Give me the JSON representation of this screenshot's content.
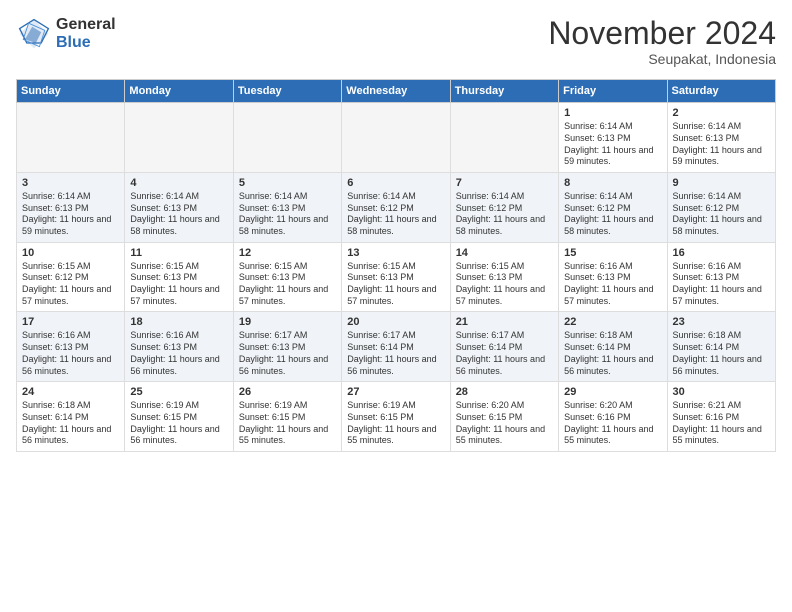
{
  "header": {
    "logo_general": "General",
    "logo_blue": "Blue",
    "month_title": "November 2024",
    "location": "Seupakat, Indonesia"
  },
  "weekdays": [
    "Sunday",
    "Monday",
    "Tuesday",
    "Wednesday",
    "Thursday",
    "Friday",
    "Saturday"
  ],
  "weeks": [
    [
      {
        "day": "",
        "info": ""
      },
      {
        "day": "",
        "info": ""
      },
      {
        "day": "",
        "info": ""
      },
      {
        "day": "",
        "info": ""
      },
      {
        "day": "",
        "info": ""
      },
      {
        "day": "1",
        "info": "Sunrise: 6:14 AM\nSunset: 6:13 PM\nDaylight: 11 hours and 59 minutes."
      },
      {
        "day": "2",
        "info": "Sunrise: 6:14 AM\nSunset: 6:13 PM\nDaylight: 11 hours and 59 minutes."
      }
    ],
    [
      {
        "day": "3",
        "info": "Sunrise: 6:14 AM\nSunset: 6:13 PM\nDaylight: 11 hours and 59 minutes."
      },
      {
        "day": "4",
        "info": "Sunrise: 6:14 AM\nSunset: 6:13 PM\nDaylight: 11 hours and 58 minutes."
      },
      {
        "day": "5",
        "info": "Sunrise: 6:14 AM\nSunset: 6:13 PM\nDaylight: 11 hours and 58 minutes."
      },
      {
        "day": "6",
        "info": "Sunrise: 6:14 AM\nSunset: 6:12 PM\nDaylight: 11 hours and 58 minutes."
      },
      {
        "day": "7",
        "info": "Sunrise: 6:14 AM\nSunset: 6:12 PM\nDaylight: 11 hours and 58 minutes."
      },
      {
        "day": "8",
        "info": "Sunrise: 6:14 AM\nSunset: 6:12 PM\nDaylight: 11 hours and 58 minutes."
      },
      {
        "day": "9",
        "info": "Sunrise: 6:14 AM\nSunset: 6:12 PM\nDaylight: 11 hours and 58 minutes."
      }
    ],
    [
      {
        "day": "10",
        "info": "Sunrise: 6:15 AM\nSunset: 6:12 PM\nDaylight: 11 hours and 57 minutes."
      },
      {
        "day": "11",
        "info": "Sunrise: 6:15 AM\nSunset: 6:13 PM\nDaylight: 11 hours and 57 minutes."
      },
      {
        "day": "12",
        "info": "Sunrise: 6:15 AM\nSunset: 6:13 PM\nDaylight: 11 hours and 57 minutes."
      },
      {
        "day": "13",
        "info": "Sunrise: 6:15 AM\nSunset: 6:13 PM\nDaylight: 11 hours and 57 minutes."
      },
      {
        "day": "14",
        "info": "Sunrise: 6:15 AM\nSunset: 6:13 PM\nDaylight: 11 hours and 57 minutes."
      },
      {
        "day": "15",
        "info": "Sunrise: 6:16 AM\nSunset: 6:13 PM\nDaylight: 11 hours and 57 minutes."
      },
      {
        "day": "16",
        "info": "Sunrise: 6:16 AM\nSunset: 6:13 PM\nDaylight: 11 hours and 57 minutes."
      }
    ],
    [
      {
        "day": "17",
        "info": "Sunrise: 6:16 AM\nSunset: 6:13 PM\nDaylight: 11 hours and 56 minutes."
      },
      {
        "day": "18",
        "info": "Sunrise: 6:16 AM\nSunset: 6:13 PM\nDaylight: 11 hours and 56 minutes."
      },
      {
        "day": "19",
        "info": "Sunrise: 6:17 AM\nSunset: 6:13 PM\nDaylight: 11 hours and 56 minutes."
      },
      {
        "day": "20",
        "info": "Sunrise: 6:17 AM\nSunset: 6:14 PM\nDaylight: 11 hours and 56 minutes."
      },
      {
        "day": "21",
        "info": "Sunrise: 6:17 AM\nSunset: 6:14 PM\nDaylight: 11 hours and 56 minutes."
      },
      {
        "day": "22",
        "info": "Sunrise: 6:18 AM\nSunset: 6:14 PM\nDaylight: 11 hours and 56 minutes."
      },
      {
        "day": "23",
        "info": "Sunrise: 6:18 AM\nSunset: 6:14 PM\nDaylight: 11 hours and 56 minutes."
      }
    ],
    [
      {
        "day": "24",
        "info": "Sunrise: 6:18 AM\nSunset: 6:14 PM\nDaylight: 11 hours and 56 minutes."
      },
      {
        "day": "25",
        "info": "Sunrise: 6:19 AM\nSunset: 6:15 PM\nDaylight: 11 hours and 56 minutes."
      },
      {
        "day": "26",
        "info": "Sunrise: 6:19 AM\nSunset: 6:15 PM\nDaylight: 11 hours and 55 minutes."
      },
      {
        "day": "27",
        "info": "Sunrise: 6:19 AM\nSunset: 6:15 PM\nDaylight: 11 hours and 55 minutes."
      },
      {
        "day": "28",
        "info": "Sunrise: 6:20 AM\nSunset: 6:15 PM\nDaylight: 11 hours and 55 minutes."
      },
      {
        "day": "29",
        "info": "Sunrise: 6:20 AM\nSunset: 6:16 PM\nDaylight: 11 hours and 55 minutes."
      },
      {
        "day": "30",
        "info": "Sunrise: 6:21 AM\nSunset: 6:16 PM\nDaylight: 11 hours and 55 minutes."
      }
    ]
  ]
}
